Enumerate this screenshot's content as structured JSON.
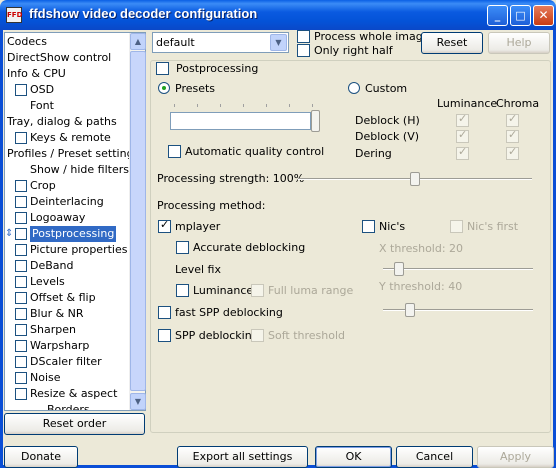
{
  "window": {
    "title": "ffdshow video decoder configuration",
    "app_icon_text": "FFD",
    "controls": {
      "minimize": "_",
      "maximize": "□",
      "close": "✕"
    }
  },
  "tree": {
    "items": [
      {
        "label": "Codecs",
        "checkbox": false,
        "indent": 0
      },
      {
        "label": "DirectShow control",
        "checkbox": false,
        "indent": 0
      },
      {
        "label": "Info & CPU",
        "checkbox": false,
        "indent": 0
      },
      {
        "label": "OSD",
        "checkbox": true,
        "indent": 1
      },
      {
        "label": "Font",
        "checkbox": false,
        "indent": 2
      },
      {
        "label": "Tray, dialog & paths",
        "checkbox": false,
        "indent": 0
      },
      {
        "label": "Keys & remote",
        "checkbox": true,
        "indent": 1
      },
      {
        "label": "Profiles / Preset settings",
        "checkbox": false,
        "indent": 0
      },
      {
        "label": "Show / hide filters",
        "checkbox": false,
        "indent": 2
      },
      {
        "label": "Crop",
        "checkbox": true,
        "indent": 1
      },
      {
        "label": "Deinterlacing",
        "checkbox": true,
        "indent": 1
      },
      {
        "label": "Logoaway",
        "checkbox": true,
        "indent": 1
      },
      {
        "label": "Postprocessing",
        "checkbox": true,
        "indent": 1,
        "selected": true
      },
      {
        "label": "Picture properties",
        "checkbox": true,
        "indent": 1
      },
      {
        "label": "DeBand",
        "checkbox": true,
        "indent": 1
      },
      {
        "label": "Levels",
        "checkbox": true,
        "indent": 1
      },
      {
        "label": "Offset & flip",
        "checkbox": true,
        "indent": 1
      },
      {
        "label": "Blur & NR",
        "checkbox": true,
        "indent": 1
      },
      {
        "label": "Sharpen",
        "checkbox": true,
        "indent": 1
      },
      {
        "label": "Warpsharp",
        "checkbox": true,
        "indent": 1
      },
      {
        "label": "DScaler filter",
        "checkbox": true,
        "indent": 1
      },
      {
        "label": "Noise",
        "checkbox": true,
        "indent": 1
      },
      {
        "label": "Resize & aspect",
        "checkbox": true,
        "indent": 1
      },
      {
        "label": "Borders",
        "checkbox": false,
        "indent": 3
      }
    ],
    "reset_order": "Reset order"
  },
  "top": {
    "preset_value": "default",
    "process_whole_image": "Process whole image",
    "only_right_half": "Only right half",
    "reset": "Reset",
    "help": "Help"
  },
  "postproc": {
    "enable_label": "Postprocessing",
    "presets_label": "Presets",
    "custom_label": "Custom",
    "auto_quality": "Automatic quality control",
    "col_luminance": "Luminance",
    "col_chroma": "Chroma",
    "deblock_h": "Deblock (H)",
    "deblock_v": "Deblock (V)",
    "dering": "Dering",
    "strength_label": "Processing strength: 100%",
    "strength_value": 100,
    "method_label": "Processing method:",
    "mplayer": "mplayer",
    "accurate_deblocking": "Accurate deblocking",
    "level_fix": "Level fix",
    "luminance": "Luminance",
    "full_luma_range": "Full luma range",
    "nics": "Nic's",
    "nics_first": "Nic's first",
    "x_threshold": "X threshold: 20",
    "y_threshold": "Y threshold: 40",
    "fast_spp": "fast SPP deblocking",
    "spp": "SPP deblocking",
    "soft_threshold": "Soft threshold"
  },
  "bottom": {
    "donate": "Donate",
    "export": "Export all settings",
    "ok": "OK",
    "cancel": "Cancel",
    "apply": "Apply"
  }
}
